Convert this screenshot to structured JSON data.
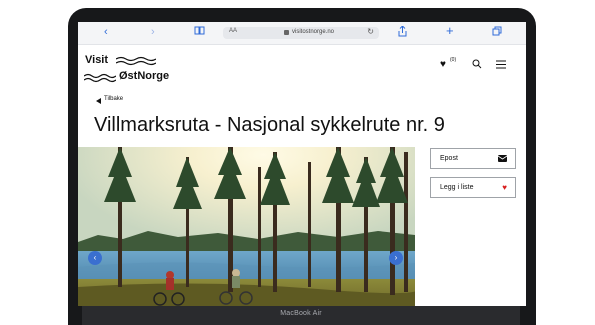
{
  "device": {
    "label": "MacBook Air"
  },
  "browser": {
    "aa": "AA",
    "url": "visitostnorge.no",
    "icons": [
      "back-icon",
      "forward-icon",
      "book-icon",
      "reload-icon",
      "share-icon",
      "plus-icon",
      "tabs-icon"
    ]
  },
  "site": {
    "logo_line1": "Visit",
    "logo_line2": "ØstNorge",
    "favorites_count": "(0)",
    "back_label": "Tilbake",
    "title": "Villmarksruta - Nasjonal sykkelrute nr. 9"
  },
  "actions": [
    {
      "label": "Epost",
      "icon": "envelope-icon"
    },
    {
      "label": "Legg i liste",
      "icon": "heart-icon",
      "icon_color": "#d81e1e"
    }
  ],
  "colors": {
    "accent": "#2f6bd8",
    "carousel": "#3a6fd0"
  }
}
